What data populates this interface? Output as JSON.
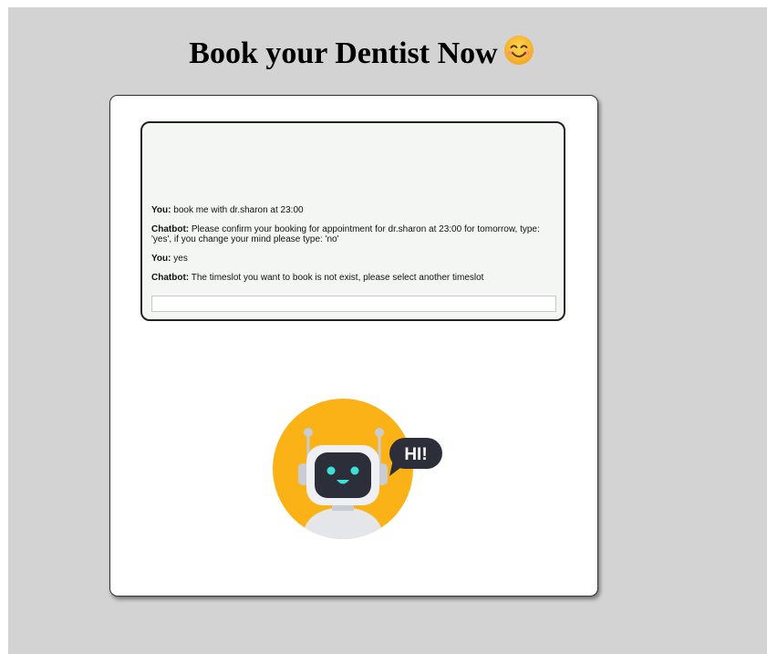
{
  "page": {
    "title": "Book your Dentist Now",
    "title_emoji": "smiling-face-emoji"
  },
  "chat": {
    "messages": [
      {
        "sender": "You:",
        "text": "book me with dr.sharon at 23:00"
      },
      {
        "sender": "Chatbot:",
        "text": "Please confirm your booking for appointment for dr.sharon at 23:00 for tomorrow, type: 'yes', if you change your mind please type: 'no'"
      },
      {
        "sender": "You:",
        "text": "yes"
      },
      {
        "sender": "Chatbot:",
        "text": "The timeslot you want to book is not exist, please select another timeslot"
      }
    ],
    "input": {
      "value": "",
      "placeholder": ""
    }
  },
  "illustration": {
    "speech_bubble": "HI!",
    "icon": "robot-icon"
  },
  "colors": {
    "page_background": "#d3d3d3",
    "card_background": "#ffffff",
    "chat_background": "#f4f6f4",
    "robot_circle": "#fbb217",
    "robot_dark": "#2c2f3a",
    "robot_eyes": "#3de0d6"
  }
}
